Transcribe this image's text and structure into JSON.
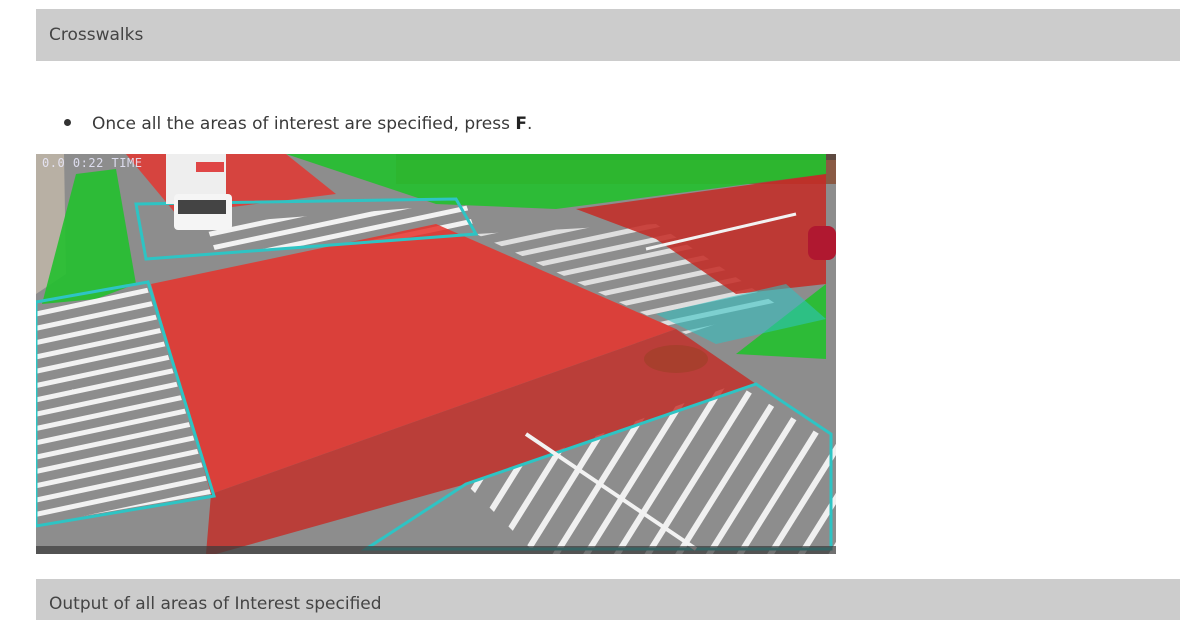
{
  "sections": {
    "top_title": "Crosswalks",
    "bottom_title": "Output of all areas of Interest specified"
  },
  "instruction": {
    "text_before": "Once all the areas of interest are specified, press ",
    "key": "F",
    "text_after": "."
  },
  "camera_view": {
    "timestamp": "0.0 0:22 TIME",
    "colors": {
      "road_zone": "#e8322c",
      "sidewalk_zone": "#22c02e",
      "crosswalk_zone": "#2ec4c4",
      "asphalt": "#8c8c8c"
    }
  }
}
